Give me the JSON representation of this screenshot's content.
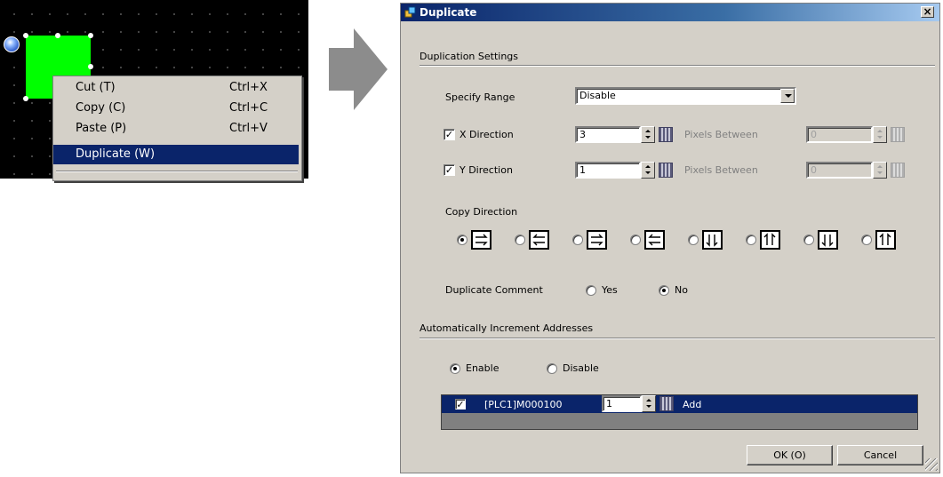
{
  "context_menu": {
    "items": [
      {
        "label": "Cut (T)",
        "shortcut": "Ctrl+X"
      },
      {
        "label": "Copy (C)",
        "shortcut": "Ctrl+C"
      },
      {
        "label": "Paste (P)",
        "shortcut": "Ctrl+V"
      },
      {
        "label": "Duplicate (W)",
        "shortcut": ""
      }
    ],
    "selected_index": 3
  },
  "dialog": {
    "title": "Duplicate",
    "close_label": "×",
    "duplication_settings": {
      "heading": "Duplication Settings",
      "specify_range_label": "Specify Range",
      "specify_range_value": "Disable",
      "x_direction": {
        "label": "X Direction",
        "checked": true,
        "value": "3",
        "pixels_between_label": "Pixels Between",
        "pixels_between_value": "0"
      },
      "y_direction": {
        "label": "Y Direction",
        "checked": true,
        "value": "1",
        "pixels_between_label": "Pixels Between",
        "pixels_between_value": "0"
      },
      "copy_direction_label": "Copy Direction",
      "copy_direction_options": [
        "right-then-down",
        "left-then-down",
        "right-then-up",
        "left-then-up",
        "down-then-right",
        "up-then-right",
        "down-then-left",
        "up-then-left"
      ],
      "copy_direction_selected": 0,
      "duplicate_comment_label": "Duplicate Comment",
      "duplicate_comment_yes": "Yes",
      "duplicate_comment_no": "No",
      "duplicate_comment_selected": "No"
    },
    "auto_increment": {
      "heading": "Automatically Increment Addresses",
      "enable_label": "Enable",
      "disable_label": "Disable",
      "selected": "Enable",
      "rows": [
        {
          "checked": true,
          "address": "[PLC1]M000100",
          "increment": "1",
          "mode": "Add"
        }
      ]
    },
    "ok_label": "OK (O)",
    "cancel_label": "Cancel"
  },
  "colors": {
    "dialog_bg": "#d4d0c8",
    "selection": "#0a246a",
    "shape_fill": "#00ff00"
  }
}
